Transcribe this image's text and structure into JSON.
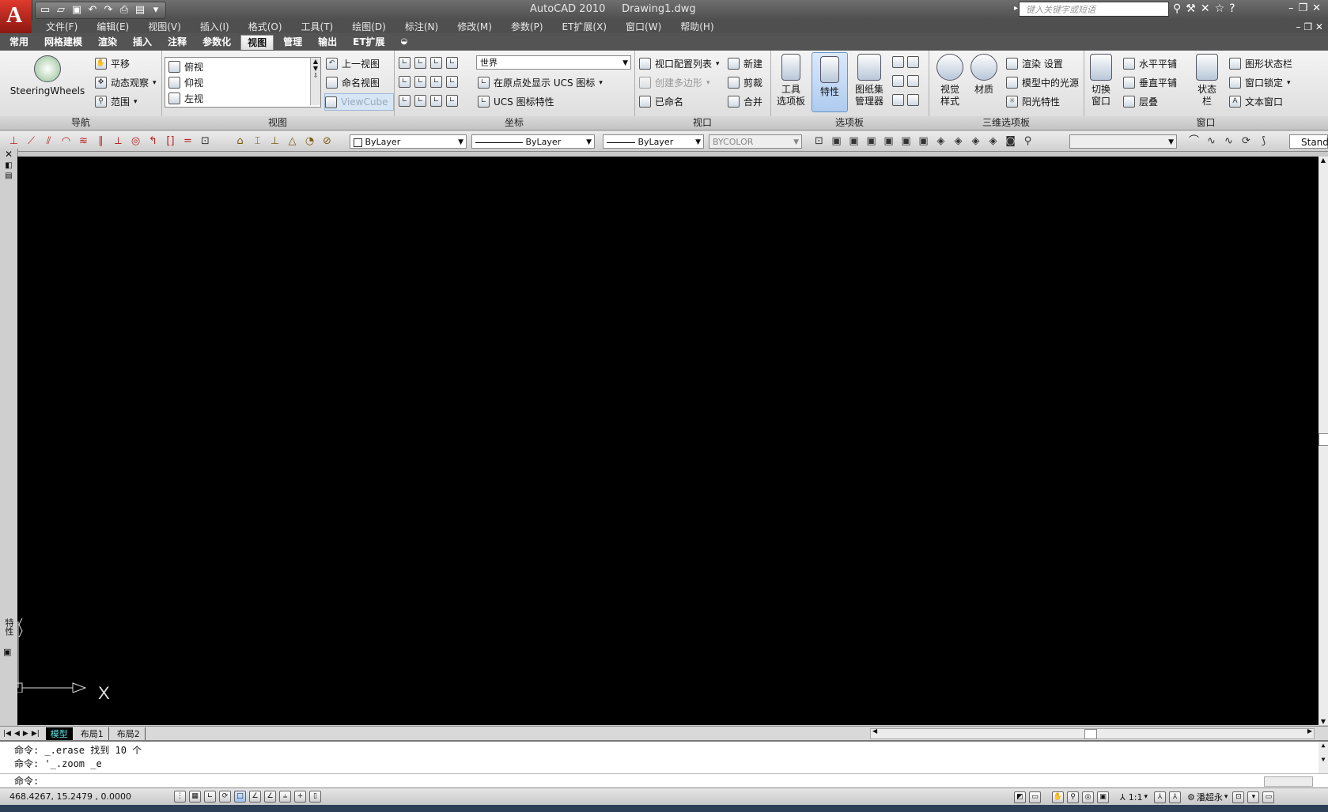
{
  "app": {
    "title": "AutoCAD 2010",
    "document": "Drawing1.dwg",
    "logo_letter": "A",
    "search_placeholder": "键入关键字或短语"
  },
  "menu": [
    "文件(F)",
    "编辑(E)",
    "视图(V)",
    "插入(I)",
    "格式(O)",
    "工具(T)",
    "绘图(D)",
    "标注(N)",
    "修改(M)",
    "参数(P)",
    "ET扩展(X)",
    "窗口(W)",
    "帮助(H)"
  ],
  "tabs": [
    {
      "label": "常用",
      "active": false
    },
    {
      "label": "网格建模",
      "active": false
    },
    {
      "label": "渲染",
      "active": false
    },
    {
      "label": "插入",
      "active": false
    },
    {
      "label": "注释",
      "active": false
    },
    {
      "label": "参数化",
      "active": false
    },
    {
      "label": "视图",
      "active": true
    },
    {
      "label": "管理",
      "active": false
    },
    {
      "label": "输出",
      "active": false
    },
    {
      "label": "ET扩展",
      "active": false
    }
  ],
  "ribbon": {
    "nav": {
      "title": "导航",
      "wheels": "SteeringWheels",
      "pan": "平移",
      "orbit": "动态观察",
      "extents": "范围"
    },
    "views": {
      "title": "视图",
      "list": [
        "俯视",
        "仰视",
        "左视"
      ],
      "prev": "上一视图",
      "named": "命名视图",
      "viewcube": "ViewCube"
    },
    "coords": {
      "title": "坐标",
      "ucs_world": "世界",
      "show_ucs": "在原点处显示 UCS 图标",
      "ucs_props": "UCS 图标特性"
    },
    "viewports": {
      "title": "视口",
      "config": "视口配置列表",
      "polygon": "创建多边形",
      "named": "已命名",
      "new": "新建",
      "clip": "剪裁",
      "join": "合并"
    },
    "palettes": {
      "title": "选项板",
      "tool": "工具",
      "tool2": "选项板",
      "props": "特性",
      "sheetset": "图纸集",
      "sheetset2": "管理器"
    },
    "palettes3d": {
      "title": "三维选项板",
      "visual": "视觉",
      "visual2": "样式",
      "material": "材质",
      "render_settings": "渲染 设置",
      "lights": "模型中的光源",
      "sun": "阳光特性"
    },
    "window": {
      "title": "窗口",
      "switch": "切换",
      "switch2": "窗口",
      "tile_h": "水平平铺",
      "tile_v": "垂直平铺",
      "cascade": "层叠",
      "status": "状态",
      "status2": "栏",
      "drawing_status": "图形状态栏",
      "window_lock": "窗口锁定",
      "text_window": "文本窗口"
    }
  },
  "props_toolbar": {
    "color": "ByLayer",
    "linetype": "ByLayer",
    "lineweight": "ByLayer",
    "plotstyle": "BYCOLOR",
    "style": "Stand"
  },
  "ucs": {
    "x_label": "X"
  },
  "left_palette": {
    "label": "特性"
  },
  "layout_tabs": [
    "模型",
    "布局1",
    "布局2"
  ],
  "command": {
    "lines": [
      "命令: _.erase 找到 10 个",
      "命令: '_.zoom _e"
    ],
    "prompt": "命令:"
  },
  "status": {
    "coords": "468.4267, 15.2479 , 0.0000",
    "scale": "1:1",
    "workspace": "潘超永"
  }
}
